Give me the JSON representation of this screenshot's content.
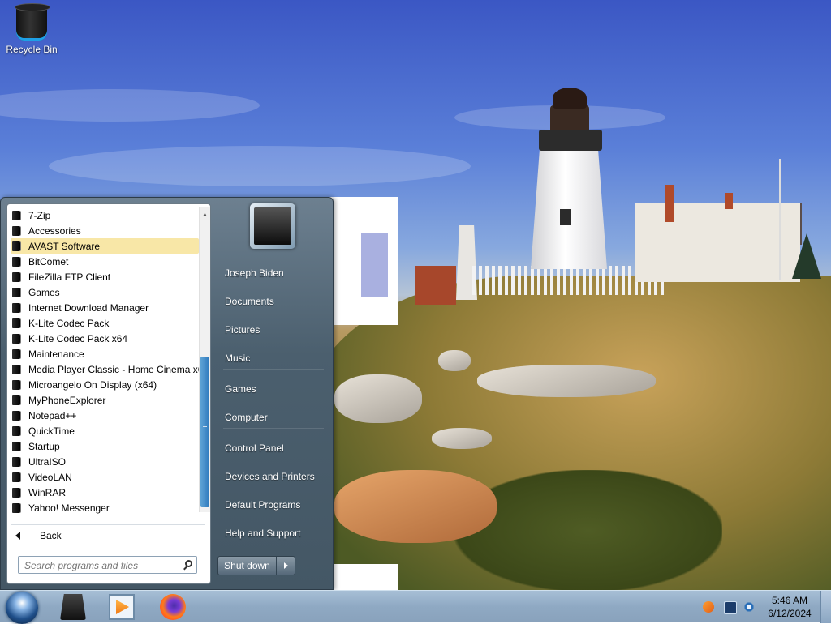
{
  "desktop": {
    "recycle_bin_label": "Recycle Bin"
  },
  "start_menu": {
    "programs": [
      {
        "label": "7-Zip",
        "selected": false
      },
      {
        "label": "Accessories",
        "selected": false
      },
      {
        "label": "AVAST Software",
        "selected": true
      },
      {
        "label": "BitComet",
        "selected": false
      },
      {
        "label": "FileZilla FTP Client",
        "selected": false
      },
      {
        "label": "Games",
        "selected": false
      },
      {
        "label": "Internet Download Manager",
        "selected": false
      },
      {
        "label": "K-Lite Codec Pack",
        "selected": false
      },
      {
        "label": "K-Lite Codec Pack x64",
        "selected": false
      },
      {
        "label": "Maintenance",
        "selected": false
      },
      {
        "label": "Media Player Classic - Home Cinema x6",
        "selected": false
      },
      {
        "label": "Microangelo On Display (x64)",
        "selected": false
      },
      {
        "label": "MyPhoneExplorer",
        "selected": false
      },
      {
        "label": "Notepad++",
        "selected": false
      },
      {
        "label": "QuickTime",
        "selected": false
      },
      {
        "label": "Startup",
        "selected": false
      },
      {
        "label": "UltraISO",
        "selected": false
      },
      {
        "label": "VideoLAN",
        "selected": false
      },
      {
        "label": "WinRAR",
        "selected": false
      },
      {
        "label": "Yahoo! Messenger",
        "selected": false
      }
    ],
    "back_label": "Back",
    "search_placeholder": "Search programs and files",
    "right_links": [
      {
        "label": "Joseph Biden",
        "name": "user-name-link"
      },
      {
        "label": "Documents",
        "name": "documents-link"
      },
      {
        "label": "Pictures",
        "name": "pictures-link"
      },
      {
        "label": "Music",
        "name": "music-link"
      },
      {
        "label": "Games",
        "name": "games-link"
      },
      {
        "label": "Computer",
        "name": "computer-link"
      },
      {
        "label": "Control Panel",
        "name": "control-panel-link"
      },
      {
        "label": "Devices and Printers",
        "name": "devices-printers-link"
      },
      {
        "label": "Default Programs",
        "name": "default-programs-link"
      },
      {
        "label": "Help and Support",
        "name": "help-support-link"
      }
    ],
    "shutdown_label": "Shut down"
  },
  "taskbar": {
    "pinned": [
      "windows-explorer-icon",
      "media-player-icon",
      "firefox-icon"
    ],
    "tray_icons": [
      "avast-icon",
      "network-icon",
      "sync-icon"
    ],
    "time": "5:46 AM",
    "date": "6/12/2024"
  }
}
